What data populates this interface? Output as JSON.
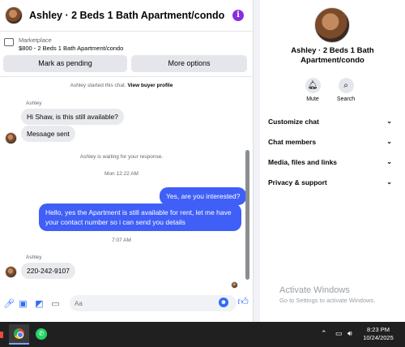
{
  "header": {
    "title": "Ashley · 2 Beds 1 Bath Apartment/condo",
    "info_icon": "info-icon"
  },
  "listing": {
    "source": "Marketplace",
    "price_title": "$800 - 2 Beds 1 Bath Apartment/condo",
    "pending_label": "Mark as pending",
    "more_label": "More options"
  },
  "messages": {
    "started_text": "Ashley started this chat.",
    "view_profile_label": "View buyer profile",
    "sender_name_1": "Ashley",
    "in_msg_1": "Hi Shaw, is this still available?",
    "in_msg_2": "Message sent",
    "waiting_text": "Ashley is waiting for your response.",
    "timestamp_1": "Mon 12:22 AM",
    "out_msg_1": "Yes, are you interested?",
    "out_msg_2": "Hello, yes the Apartment is still available for rent, let me have your contact number so i can send you details",
    "timestamp_2": "7:07 AM",
    "sender_name_2": "Ashley",
    "in_msg_3": "220-242-9107"
  },
  "composer": {
    "placeholder": "Aa"
  },
  "details": {
    "name": "Ashley · 2 Beds 1 Bath Apartment/condo",
    "name_line1": "Ashley · 2 Beds 1 Bath",
    "name_line2": "Apartment/condo",
    "mute_label": "Mute",
    "search_label": "Search",
    "sections": [
      "Customize chat",
      "Chat members",
      "Media, files and links",
      "Privacy & support"
    ]
  },
  "watermark": {
    "title": "Activate Windows",
    "subtitle": "Go to Settings to activate Windows."
  },
  "taskbar": {
    "time": "8:23 PM",
    "date": "10/24/2025"
  },
  "colors": {
    "accent": "#3f5ff7",
    "info": "#8a2be2",
    "taskbar": "#202020"
  }
}
